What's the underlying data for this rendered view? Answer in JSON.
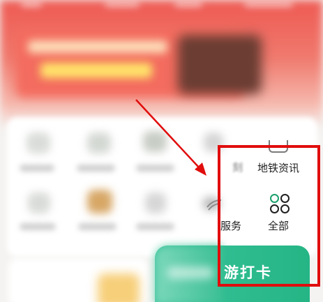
{
  "menu_items": {
    "metro_info": {
      "label": "地铁资讯",
      "icon": "metro-icon"
    },
    "services_partial": {
      "label": "服务",
      "icon": "service-icon"
    },
    "all": {
      "label": "全部",
      "icon": "grid-four-icon"
    },
    "partial_blurred": {
      "label": "刻"
    }
  },
  "checkin_button": {
    "label_visible": "游打卡"
  },
  "colors": {
    "annotation_red": "#e10d0d",
    "button_green": "#25b585",
    "banner_red": "#ee5a53",
    "accent_green": "#1aa06b"
  }
}
